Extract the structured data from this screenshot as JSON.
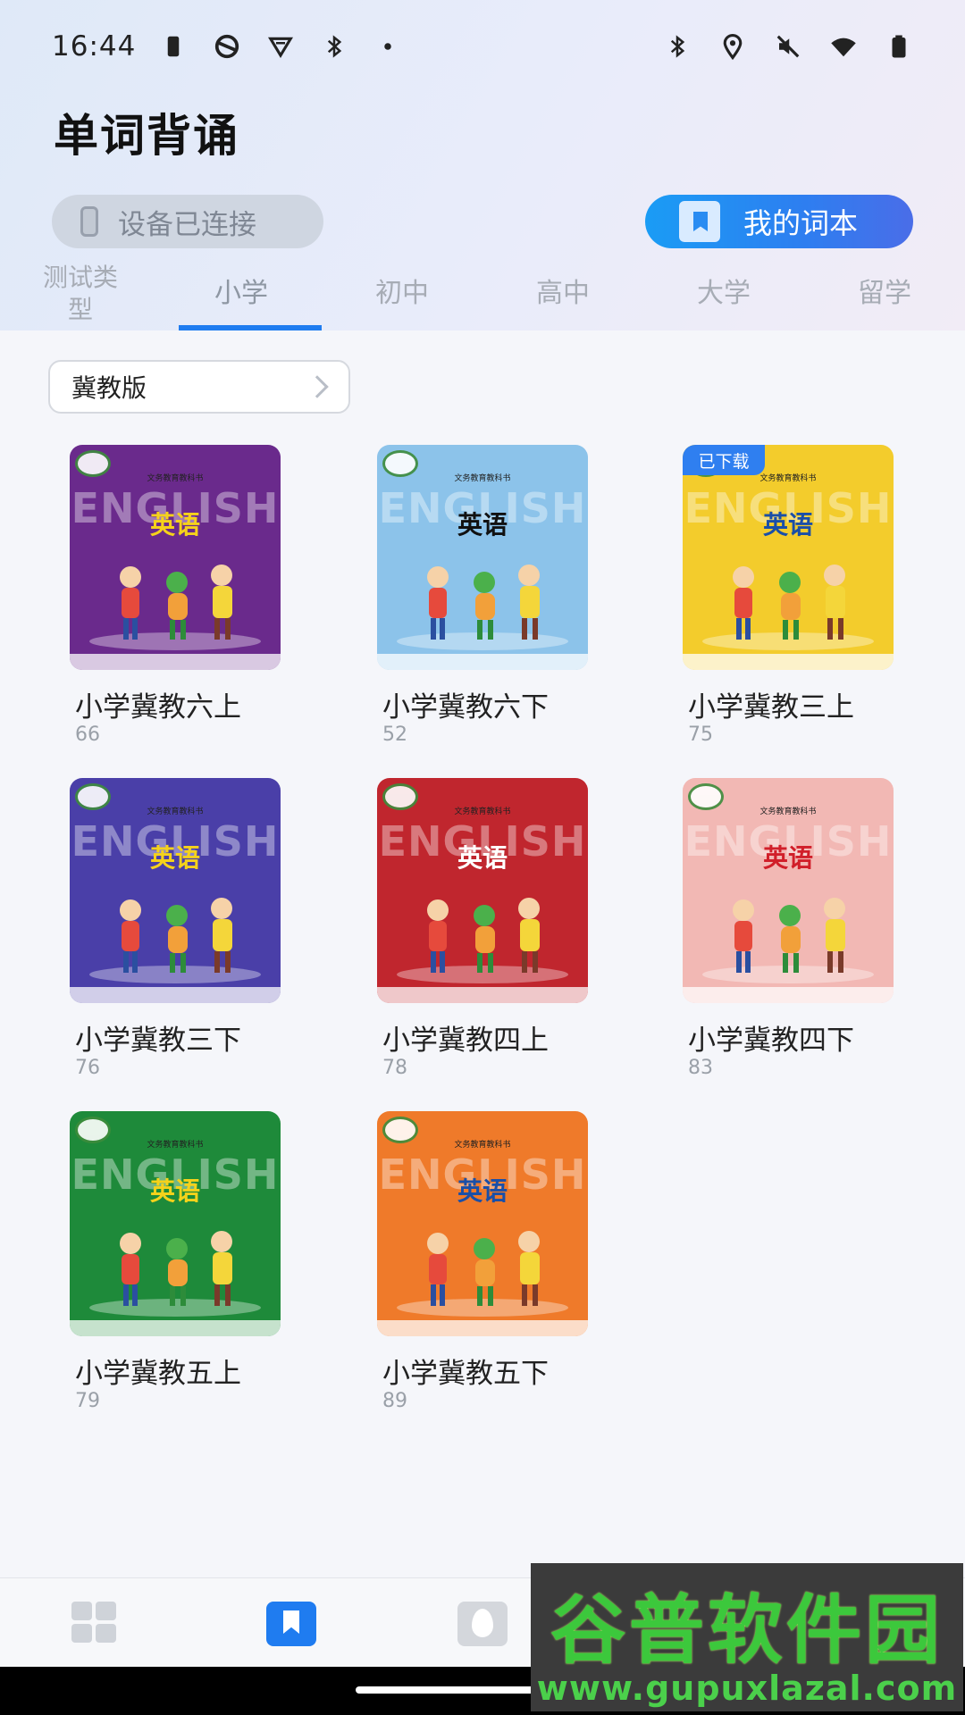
{
  "status_bar": {
    "time": "16:44",
    "left_icons": [
      "battery-saver-icon",
      "vpn-icon",
      "shield-icon",
      "bluetooth-icon",
      "dot-icon"
    ],
    "right_icons": [
      "bluetooth-icon",
      "location-icon",
      "mute-icon",
      "wifi-icon",
      "battery-icon"
    ]
  },
  "header": {
    "title": "单词背诵",
    "device_status": "设备已连接",
    "wordbook_button": "我的词本"
  },
  "tabs": [
    {
      "label": "测试类型"
    },
    {
      "label": "小学",
      "active": true
    },
    {
      "label": "初中"
    },
    {
      "label": "高中"
    },
    {
      "label": "大学"
    },
    {
      "label": "留学"
    }
  ],
  "filter": {
    "label": "冀教版"
  },
  "books": [
    {
      "title": "小学冀教六上",
      "count": "66",
      "cover_color": "#6a2a8c",
      "title_color": "#f5d21b",
      "downloaded": false
    },
    {
      "title": "小学冀教六下",
      "count": "52",
      "cover_color": "#8cc3ea",
      "title_color": "#111111",
      "downloaded": false
    },
    {
      "title": "小学冀教三上",
      "count": "75",
      "cover_color": "#f3cc2c",
      "title_color": "#1a4fa8",
      "downloaded": true,
      "badge": "已下载"
    },
    {
      "title": "小学冀教三下",
      "count": "76",
      "cover_color": "#4a3fa8",
      "title_color": "#f5d21b",
      "downloaded": false
    },
    {
      "title": "小学冀教四上",
      "count": "78",
      "cover_color": "#c0262e",
      "title_color": "#ffffff",
      "downloaded": false
    },
    {
      "title": "小学冀教四下",
      "count": "83",
      "cover_color": "#f2b8b4",
      "title_color": "#d11f2a",
      "downloaded": false
    },
    {
      "title": "小学冀教五上",
      "count": "79",
      "cover_color": "#1e8a3a",
      "title_color": "#f5d21b",
      "downloaded": false
    },
    {
      "title": "小学冀教五下",
      "count": "89",
      "cover_color": "#ef7a2a",
      "title_color": "#1a4fa8",
      "downloaded": false
    }
  ],
  "cover_text": {
    "series": "文务教育教科书",
    "english": "ENGLISH",
    "subject": "英语"
  },
  "bottom_nav": [
    {
      "icon": "dashboard-icon"
    },
    {
      "icon": "wordbook-icon",
      "active": true
    },
    {
      "icon": "fire-icon"
    }
  ],
  "watermark": {
    "main": "谷普软件园",
    "url": "www.gupuxlazal.com"
  },
  "accent_color": "#1f7cf0"
}
